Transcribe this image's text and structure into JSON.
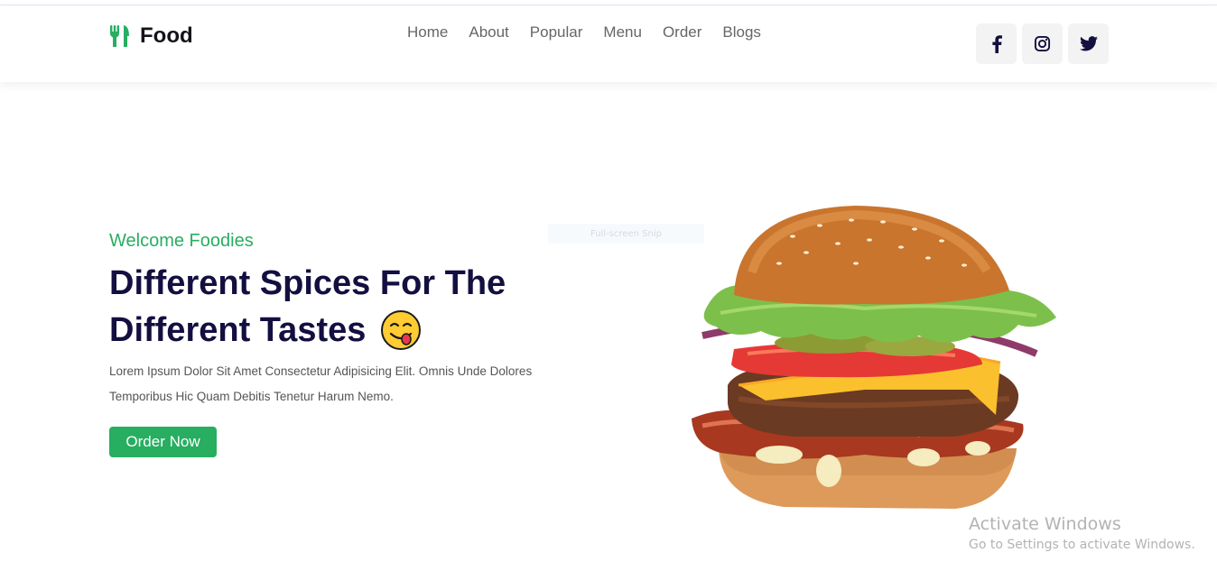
{
  "header": {
    "logo_text": "Food",
    "logo_icon": "utensils-icon",
    "nav": [
      {
        "label": "Home"
      },
      {
        "label": "About"
      },
      {
        "label": "Popular"
      },
      {
        "label": "Menu"
      },
      {
        "label": "Order"
      },
      {
        "label": "Blogs"
      }
    ],
    "socials": [
      {
        "icon": "facebook-icon"
      },
      {
        "icon": "instagram-icon"
      },
      {
        "icon": "twitter-icon"
      }
    ]
  },
  "hero": {
    "subtitle": "Welcome Foodies",
    "title_line1": "Different Spices For The",
    "title_line2": "Different Tastes",
    "title_emoji": "face-savoring-food-icon",
    "description": "Lorem Ipsum Dolor Sit Amet Consectetur Adipisicing Elit. Omnis Unde Dolores Temporibus Hic Quam Debitis Tenetur Harum Nemo.",
    "button_label": "Order Now",
    "image": "burger-image"
  },
  "overlay": {
    "snip_label": "Full-screen Snip",
    "activate_title": "Activate Windows",
    "activate_sub": "Go to Settings to activate Windows."
  },
  "colors": {
    "accent": "#27ae60",
    "heading": "#130f40"
  }
}
